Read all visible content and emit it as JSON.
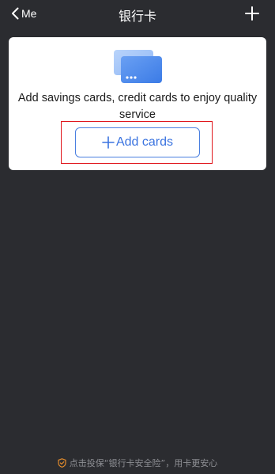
{
  "nav": {
    "back_label": "Me",
    "title": "银行卡",
    "add_icon": "plus-icon"
  },
  "panel": {
    "illustration_icon": "credit-card-icon",
    "message": "Add savings cards, credit cards to enjoy quality service",
    "button_label": "Add cards"
  },
  "footer": {
    "text": "点击投保“银行卡安全险”，用卡更安心",
    "icon": "shield-icon"
  },
  "colors": {
    "background": "#2b2c30",
    "accent": "#3b74e0",
    "highlight": "#e0161c"
  }
}
